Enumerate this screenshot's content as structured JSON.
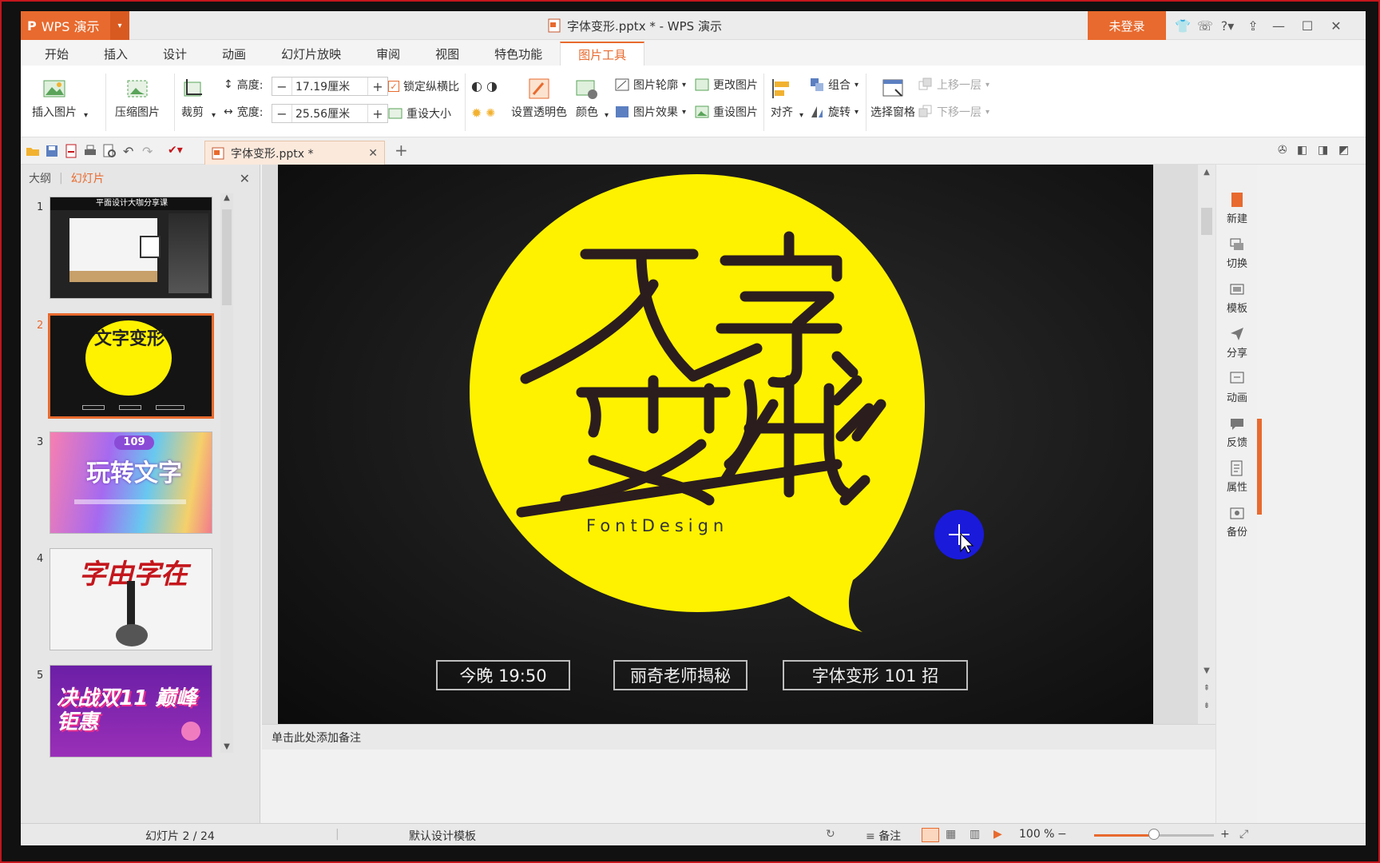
{
  "window": {
    "app_name": "WPS 演示",
    "doc_title": "字体变形.pptx * - WPS 演示",
    "login": "未登录"
  },
  "tabs": [
    "开始",
    "插入",
    "设计",
    "动画",
    "幻灯片放映",
    "审阅",
    "视图",
    "特色功能",
    "图片工具"
  ],
  "active_tab": "图片工具",
  "ribbon": {
    "insert_picture": "插入图片",
    "compress_picture": "压缩图片",
    "crop": "裁剪",
    "height_label": "高度:",
    "height_value": "17.19厘米",
    "width_label": "宽度:",
    "width_value": "25.56厘米",
    "lock_ratio": "锁定纵横比",
    "resize": "重设大小",
    "set_transparent": "设置透明色",
    "color": "颜色",
    "outline": "图片轮廓",
    "effect": "图片效果",
    "change_picture": "更改图片",
    "reset_picture": "重设图片",
    "align": "对齐",
    "group": "组合",
    "rotate": "旋转",
    "selection_pane": "选择窗格",
    "bring_forward": "上移一层",
    "send_backward": "下移一层"
  },
  "doc_tab": {
    "name": "字体变形.pptx *"
  },
  "left_panel": {
    "outline_tab": "大纲",
    "slides_tab": "幻灯片",
    "thumbnails": [
      {
        "num": "1",
        "title": "平面设计大咖分享课"
      },
      {
        "num": "2",
        "title": "文字变形"
      },
      {
        "num": "3",
        "title": "玩转文字",
        "badge": "109"
      },
      {
        "num": "4",
        "title": "字由字在"
      },
      {
        "num": "5",
        "title": "决战双11 巅峰钜惠"
      }
    ]
  },
  "slide": {
    "headline_1": "文字",
    "headline_2": "变形",
    "subtitle": "FontDesign",
    "boxes": [
      "今晚 19:50",
      "丽奇老师揭秘",
      "字体变形 101 招"
    ]
  },
  "notes_placeholder": "单击此处添加备注",
  "task_pane": [
    "新建",
    "切换",
    "模板",
    "分享",
    "动画",
    "反馈",
    "属性",
    "备份"
  ],
  "status": {
    "slide_counter": "幻灯片 2 / 24",
    "template": "默认设计模板",
    "notes": "备注",
    "zoom": "100 %",
    "zoom_fraction": 0.5
  },
  "colors": {
    "accent": "#e86a2e",
    "slide_yellow": "#fff200",
    "cursor_blue": "#1a1adb"
  }
}
